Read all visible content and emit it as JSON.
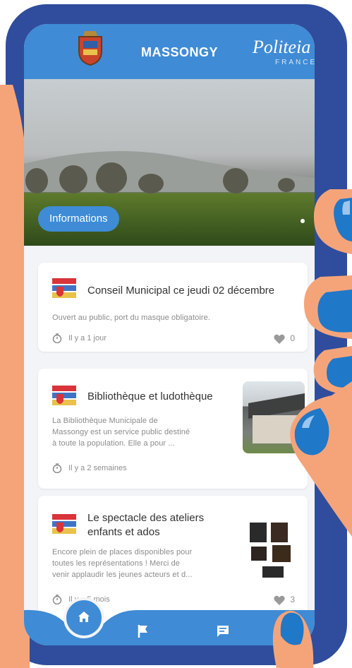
{
  "header": {
    "title": "MASSONGY",
    "logo_text": "Politeia",
    "logo_sub": "FRANCE"
  },
  "hero": {
    "chip_label": "Informations"
  },
  "posts": [
    {
      "title": "Conseil Municipal ce jeudi 02 décembre",
      "description": "Ouvert au public, port du masque obligatoire.",
      "time": "Il y a 1 jour",
      "likes": "0"
    },
    {
      "title": "Bibliothèque et ludothèque",
      "description_lines": [
        "La Bibliothèque Municipale de",
        "Massongy est un service public destiné",
        "à toute la population. Elle a pour ..."
      ],
      "time": "Il y a 2 semaines"
    },
    {
      "title_lines": [
        "Le spectacle des ateliers",
        "enfants et ados"
      ],
      "description_lines": [
        "Encore plein de places disponibles pour",
        "toutes les représentations ! Merci de",
        "venir applaudir les jeunes acteurs et d..."
      ],
      "time": "Il y a 5 mois",
      "likes": "3"
    }
  ],
  "navigation": {
    "items": [
      "home-icon",
      "flag-icon",
      "message-icon",
      "person-icon"
    ]
  },
  "colors": {
    "primary": "#3f8bd5",
    "frame": "#2f4d9c",
    "hand": "#f5a47a",
    "nail": "#1f78c8"
  }
}
